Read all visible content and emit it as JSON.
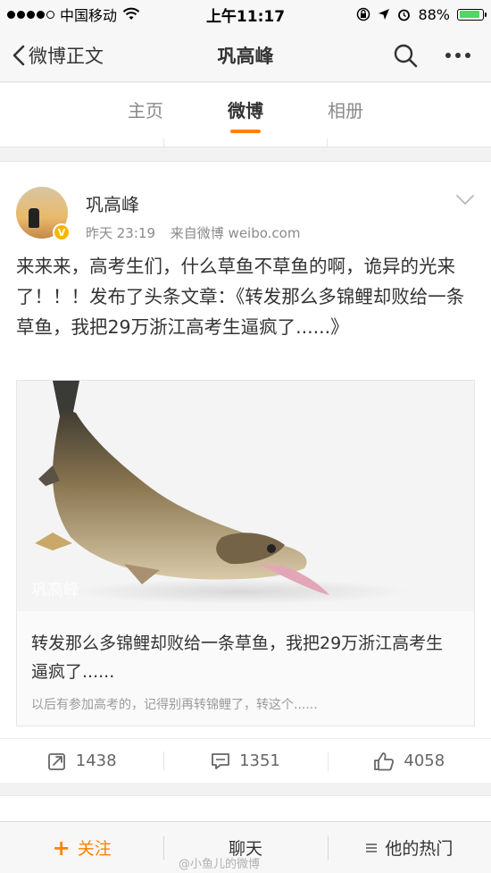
{
  "status_bar": {
    "carrier": "中国移动",
    "time": "上午11:17",
    "battery_percent": "88%",
    "battery_level": 0.88
  },
  "nav": {
    "back_label": "微博正文",
    "title": "巩高峰"
  },
  "tabs": [
    {
      "label": "主页",
      "active": false
    },
    {
      "label": "微博",
      "active": true
    },
    {
      "label": "相册",
      "active": false
    }
  ],
  "post": {
    "username": "巩高峰",
    "time": "昨天 23:19",
    "source": "来自微博 weibo.com",
    "text": "来来来，高考生们，什么草鱼不草鱼的啊，诡异的光来了！！！发布了头条文章：《转发那么多锦鲤却败给一条草鱼，我把29万浙江高考生逼疯了......》",
    "article": {
      "image_watermark": "巩高峰",
      "title": "转发那么多锦鲤却败给一条草鱼，我把29万浙江高考生逼疯了......",
      "description": "以后有参加高考的，记得别再转锦鲤了，转这个......"
    },
    "actions": {
      "repost_count": "1438",
      "comment_count": "1351",
      "like_count": "4058"
    }
  },
  "bottom_bar": {
    "follow_label": "关注",
    "chat_label": "聊天",
    "hot_label": "他的热门",
    "watermark": "@小鱼儿的微博"
  },
  "colors": {
    "accent": "#ff8200",
    "verified_badge": "#f7b500",
    "battery_fill": "#4cd964"
  }
}
